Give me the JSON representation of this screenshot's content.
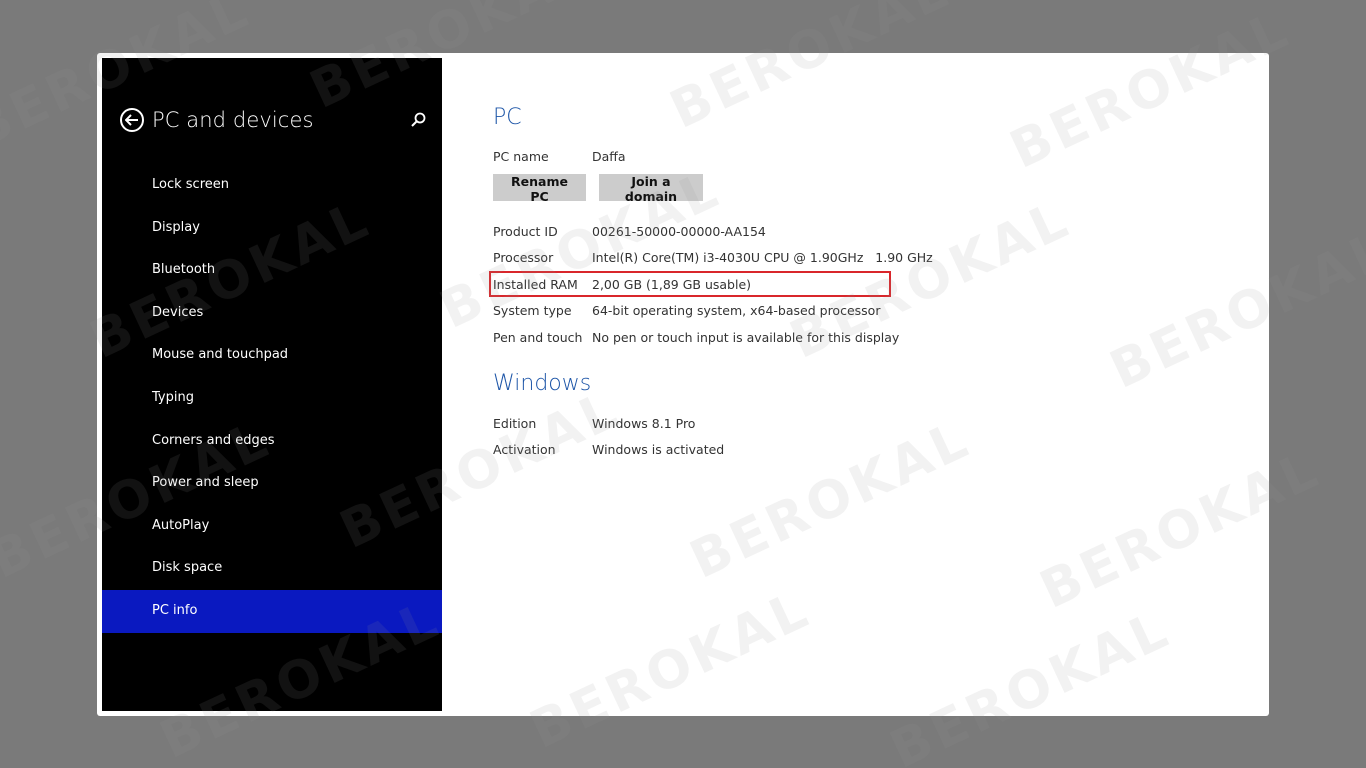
{
  "sidebar": {
    "title": "PC and devices",
    "items": [
      {
        "label": "Lock screen"
      },
      {
        "label": "Display"
      },
      {
        "label": "Bluetooth"
      },
      {
        "label": "Devices"
      },
      {
        "label": "Mouse and touchpad"
      },
      {
        "label": "Typing"
      },
      {
        "label": "Corners and edges"
      },
      {
        "label": "Power and sleep"
      },
      {
        "label": "AutoPlay"
      },
      {
        "label": "Disk space"
      },
      {
        "label": "PC info"
      }
    ],
    "active_item": "PC info"
  },
  "pc": {
    "title": "PC",
    "name_label": "PC name",
    "name_value": "Daffa",
    "rename_button": "Rename PC",
    "join_button": "Join a domain",
    "product_id_label": "Product ID",
    "product_id_value": "00261-50000-00000-AA154",
    "processor_label": "Processor",
    "processor_value": "Intel(R) Core(TM) i3-4030U CPU @ 1.90GHz   1.90 GHz",
    "ram_label": "Installed RAM",
    "ram_value": "2,00 GB (1,89 GB usable)",
    "system_type_label": "System type",
    "system_type_value": "64-bit operating system, x64-based processor",
    "pen_label": "Pen and touch",
    "pen_value": "No pen or touch input is available for this display"
  },
  "windows": {
    "title": "Windows",
    "edition_label": "Edition",
    "edition_value": "Windows 8.1 Pro",
    "activation_label": "Activation",
    "activation_value": "Windows is activated"
  },
  "watermark": "BEROKAL",
  "colors": {
    "accent": "#1e56a8",
    "active_nav": "#0a19c0",
    "highlight": "#d9262b"
  }
}
